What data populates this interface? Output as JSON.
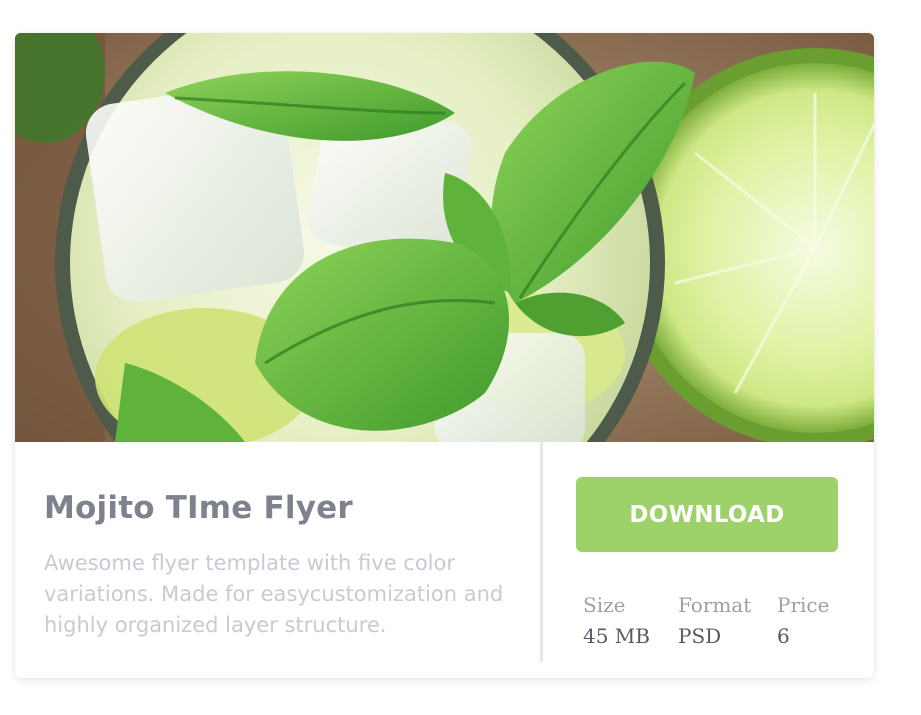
{
  "product": {
    "title": "Mojito TIme Flyer",
    "description": "Awesome flyer template with five color variations. Made for easycustomization and highly organized layer structure.",
    "image_subject": "mojito-glass-with-mint-and-lime"
  },
  "actions": {
    "download_label": "DOWNLOAD"
  },
  "meta": [
    {
      "label": "Size",
      "value": "45 MB"
    },
    {
      "label": "Format",
      "value": "PSD"
    },
    {
      "label": "Price",
      "value": "6"
    }
  ],
  "colors": {
    "accent": "#9dd16a",
    "title": "#7d828c",
    "description": "#c8cad4",
    "divider": "#e6e8ef"
  }
}
